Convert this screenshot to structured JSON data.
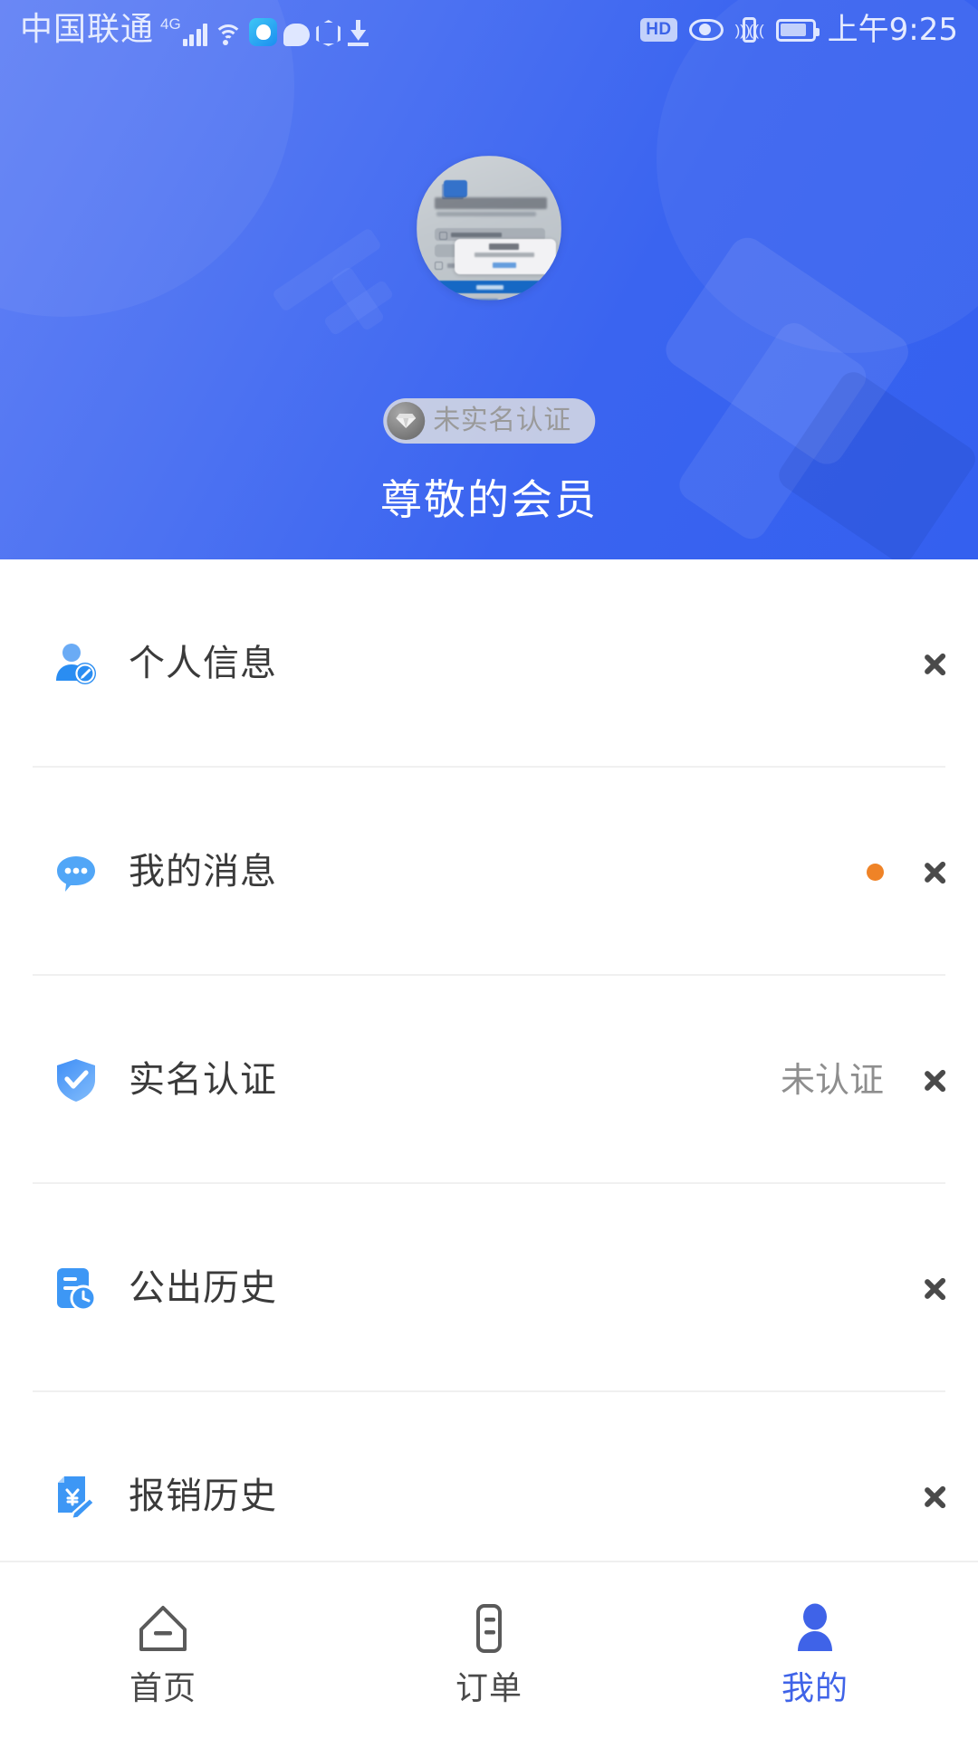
{
  "status_bar": {
    "carrier": "中国联通",
    "network_type": "4G",
    "signal_icon": "signal-bars-icon",
    "wifi_icon": "wifi-icon",
    "app_icon": "customer-service-app-icon",
    "message_icon": "chat-bubble-icon",
    "block_icon": "hand-stop-icon",
    "download_icon": "download-icon",
    "hd_label": "HD",
    "eye_icon": "eye-care-icon",
    "vibrate_icon": "vibrate-icon",
    "battery_icon": "battery-icon",
    "time": "上午9:25"
  },
  "header": {
    "avatar_alt": "user-avatar-screenshot",
    "verify_badge": {
      "icon": "diamond-gem-icon",
      "label": "未实名认证"
    },
    "member_title": "尊敬的会员",
    "accent_color": "#3a64f0"
  },
  "menu": {
    "items": [
      {
        "icon": "user-edit-icon",
        "label": "个人信息",
        "value": "",
        "has_dot": false,
        "chevron": "chevron-right-icon"
      },
      {
        "icon": "chat-message-icon",
        "label": "我的消息",
        "value": "",
        "has_dot": true,
        "dot_color": "#ef8327",
        "chevron": "chevron-right-icon"
      },
      {
        "icon": "shield-check-icon",
        "label": "实名认证",
        "value": "未认证",
        "has_dot": false,
        "chevron": "chevron-right-icon"
      },
      {
        "icon": "document-clock-icon",
        "label": "公出历史",
        "value": "",
        "has_dot": false,
        "chevron": "chevron-right-icon"
      },
      {
        "icon": "receipt-yuan-pencil-icon",
        "label": "报销历史",
        "value": "",
        "has_dot": false,
        "chevron": "chevron-right-icon"
      }
    ]
  },
  "tabbar": {
    "active_index": 2,
    "active_color": "#3f63e8",
    "inactive_color": "#4a4a4a",
    "tabs": [
      {
        "icon": "home-icon",
        "label": "首页"
      },
      {
        "icon": "order-list-icon",
        "label": "订单"
      },
      {
        "icon": "profile-person-icon",
        "label": "我的"
      }
    ]
  }
}
